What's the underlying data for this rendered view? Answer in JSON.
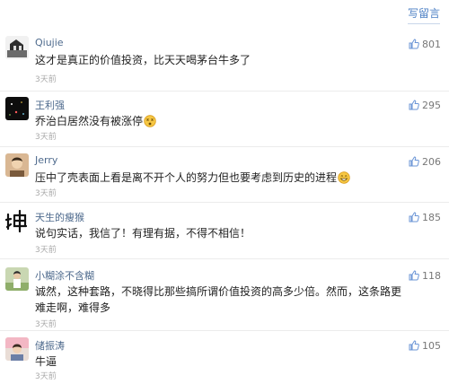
{
  "header": {
    "write_comment_label": "写留言"
  },
  "colors": {
    "link_blue": "#4b7fc4",
    "username_blue": "#4e6a8d",
    "time_gray": "#aaaaaa",
    "like_icon_blue": "#6b95d6"
  },
  "comments": [
    {
      "username": "Qiujie",
      "text": "这才是真正的价值投资，比天天喝茅台牛多了",
      "time": "3天前",
      "likes": "801"
    },
    {
      "username": "王利强",
      "text": "乔治白居然没有被涨停",
      "emoji": "dizzy-face-emoji",
      "time": "3天前",
      "likes": "295"
    },
    {
      "username": "Jerry",
      "text": "压中了壳表面上看是离不开个人的努力但也要考虑到历史的进程",
      "emoji": "grinning-face-emoji",
      "time": "3天前",
      "likes": "206"
    },
    {
      "username": "天生的瘦猴",
      "text": "说句实话，我信了！有理有据，不得不相信！",
      "time": "3天前",
      "likes": "185"
    },
    {
      "username": "小糊涂不含糊",
      "text": "诚然，这种套路，不晓得比那些搞所谓价值投资的高多少倍。然而，这条路更难走啊，难得多",
      "time": "3天前",
      "likes": "118"
    },
    {
      "username": "储振涛",
      "text": "牛逼",
      "time": "3天前",
      "likes": "105"
    }
  ]
}
